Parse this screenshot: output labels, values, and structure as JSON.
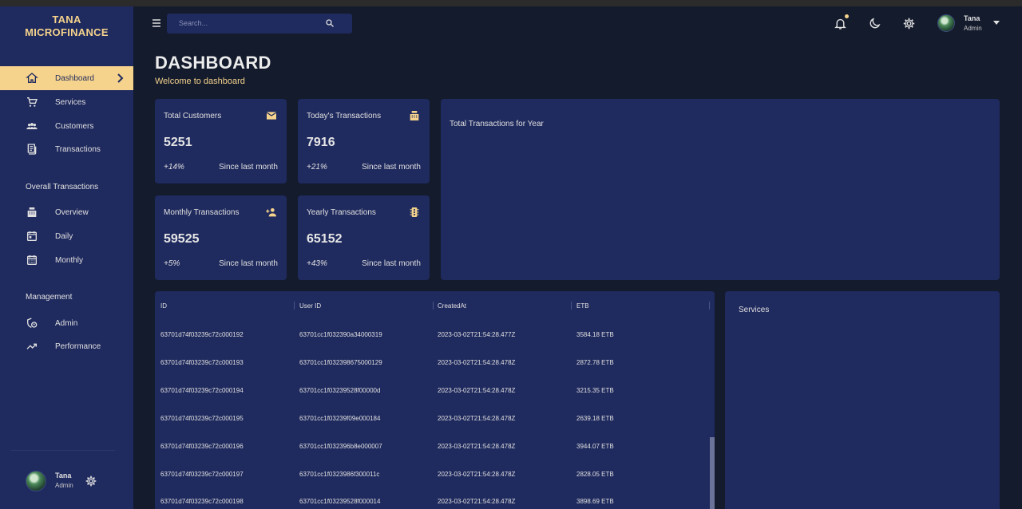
{
  "brand": {
    "line1": "TANA",
    "line2": "MICROFINANCE"
  },
  "sidebar": {
    "items": [
      {
        "label": "Dashboard",
        "icon": "home-icon",
        "active": true
      },
      {
        "label": "Services",
        "icon": "cart-icon"
      },
      {
        "label": "Customers",
        "icon": "people-icon"
      },
      {
        "label": "Transactions",
        "icon": "receipt-icon"
      }
    ],
    "section_overall": "Overall Transactions",
    "overall_items": [
      {
        "label": "Overview",
        "icon": "cash-register-icon"
      },
      {
        "label": "Daily",
        "icon": "calendar-today-icon"
      },
      {
        "label": "Monthly",
        "icon": "calendar-month-icon"
      }
    ],
    "section_management": "Management",
    "management_items": [
      {
        "label": "Admin",
        "icon": "admin-shield-icon"
      },
      {
        "label": "Performance",
        "icon": "trending-up-icon"
      }
    ],
    "user": {
      "name": "Tana",
      "role": "Admin"
    }
  },
  "topbar": {
    "search_placeholder": "Search...",
    "user": {
      "name": "Tana",
      "role": "Admin"
    }
  },
  "page": {
    "title": "DASHBOARD",
    "subtitle": "Welcome to dashboard"
  },
  "stats": [
    {
      "title": "Total Customers",
      "value": "5251",
      "change": "+14%",
      "since": "Since last month",
      "icon": "mail-icon"
    },
    {
      "title": "Today's Transactions",
      "value": "7916",
      "change": "+21%",
      "since": "Since last month",
      "icon": "cash-register-icon"
    },
    {
      "title": "Monthly Transactions",
      "value": "59525",
      "change": "+5%",
      "since": "Since last month",
      "icon": "person-add-icon"
    },
    {
      "title": "Yearly Transactions",
      "value": "65152",
      "change": "+43%",
      "since": "Since last month",
      "icon": "traffic-icon"
    }
  ],
  "yearly_chart": {
    "title": "Total Transactions for Year"
  },
  "table": {
    "columns": [
      "ID",
      "User ID",
      "CreatedAt",
      "ETB"
    ],
    "rows": [
      [
        "63701d74f03239c72c000192",
        "63701cc1f032390a34000319",
        "2023-03-02T21:54:28.477Z",
        "3584.18 ETB"
      ],
      [
        "63701d74f03239c72c000193",
        "63701cc1f032398675000129",
        "2023-03-02T21:54:28.478Z",
        "2872.78 ETB"
      ],
      [
        "63701d74f03239c72c000194",
        "63701cc1f03239528f00000d",
        "2023-03-02T21:54:28.478Z",
        "3215.35 ETB"
      ],
      [
        "63701d74f03239c72c000195",
        "63701cc1f03239f09e000184",
        "2023-03-02T21:54:28.478Z",
        "2639.18 ETB"
      ],
      [
        "63701d74f03239c72c000196",
        "63701cc1f032396b8e000007",
        "2023-03-02T21:54:28.478Z",
        "3944.07 ETB"
      ],
      [
        "63701d74f03239c72c000197",
        "63701cc1f0323986f300011c",
        "2023-03-02T21:54:28.478Z",
        "2828.05 ETB"
      ],
      [
        "63701d74f03239c72c000198",
        "63701cc1f03239528f000014",
        "2023-03-02T21:54:28.478Z",
        "3898.69 ETB"
      ]
    ]
  },
  "services_panel": {
    "title": "Services"
  },
  "colors": {
    "accent": "#f5d38c",
    "panel": "#1f2a5e",
    "background": "#141b2d"
  }
}
